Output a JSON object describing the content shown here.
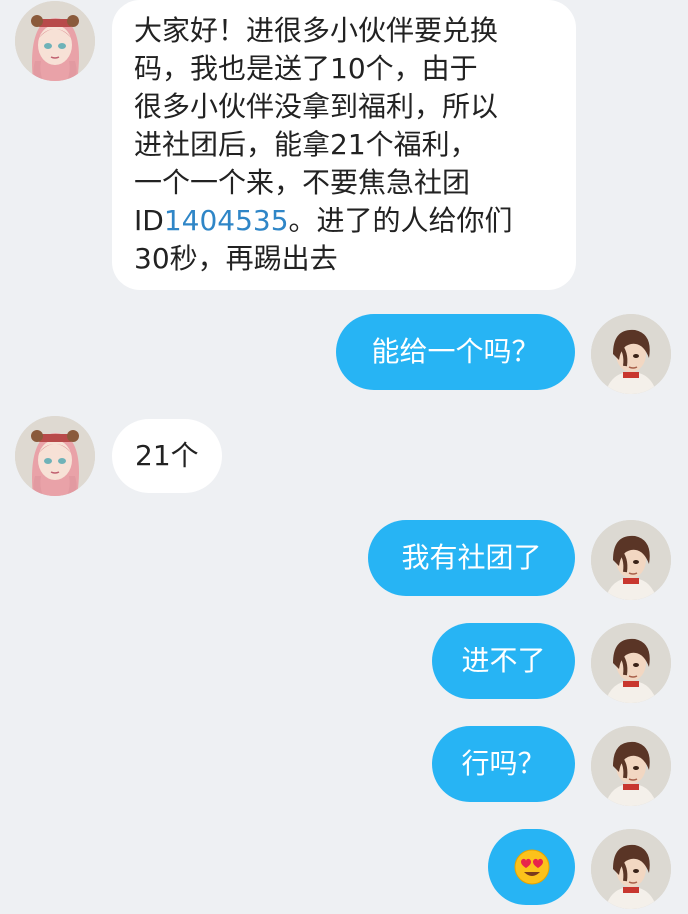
{
  "messages": [
    {
      "side": "incoming",
      "lines": [
        "大家好！进很多小伙伴要兑换",
        "码，我也是送了10个，由于",
        "很多小伙伴没拿到福利，所以",
        "进社团后，能拿21个福利，",
        "一个一个来，不要焦急社团"
      ],
      "id_prefix": "ID",
      "id_value": "1404535",
      "id_suffix": "。进了的人给你们",
      "last_line": "30秒，再踢出去"
    },
    {
      "side": "outgoing",
      "text": "能给一个吗？"
    },
    {
      "side": "incoming",
      "text": "21个"
    },
    {
      "side": "outgoing",
      "text": "我有社团了"
    },
    {
      "side": "outgoing",
      "text": "进不了"
    },
    {
      "side": "outgoing",
      "text": "行吗？"
    },
    {
      "side": "outgoing",
      "emoji": "heart-eyes-emoji"
    }
  ],
  "colors": {
    "background": "#eef0f3",
    "incoming_bubble": "#ffffff",
    "outgoing_bubble": "#27b4f4",
    "link": "#2f86c7"
  },
  "avatars": {
    "incoming": "pink-haired-girl-avatar",
    "outgoing": "brown-haired-boy-avatar"
  }
}
